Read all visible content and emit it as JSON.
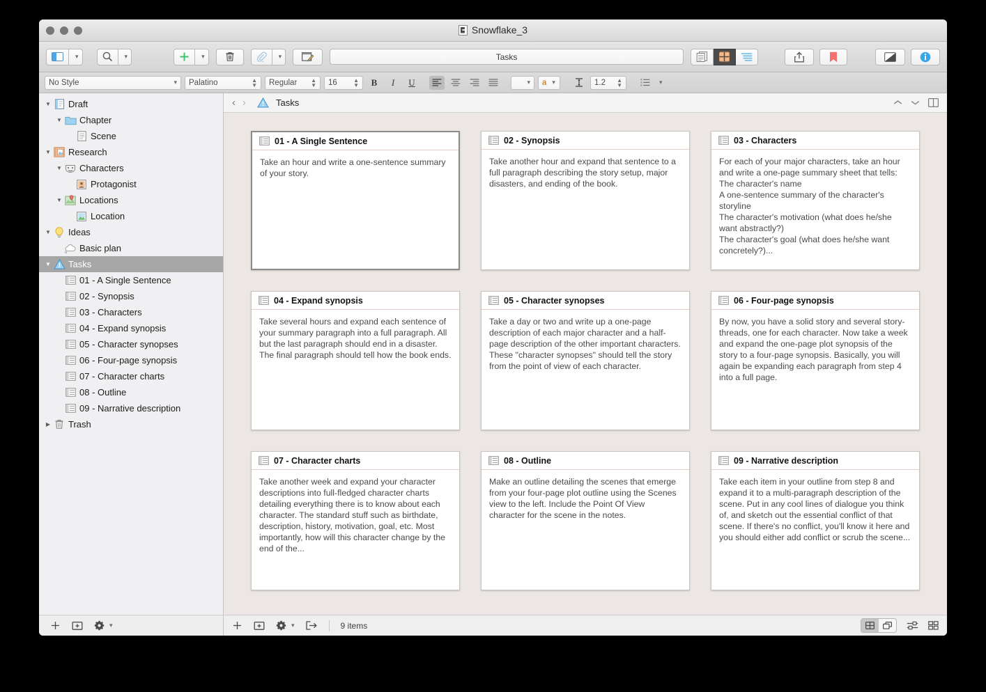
{
  "window": {
    "title": "Snowflake_3",
    "doc_icon": "scrivener-document-icon"
  },
  "toolbar": {
    "view_layout_label": "view-layout",
    "search_label": "search",
    "add_label": "add",
    "trash_label": "trash",
    "attach_label": "attach",
    "compose_label": "compose",
    "title_field_value": "Tasks",
    "mode_scrivenings": "scrivenings-view",
    "mode_corkboard": "corkboard-view",
    "mode_outliner": "outliner-view",
    "share_label": "share",
    "bookmark_label": "bookmark",
    "inspector_toggle_label": "toggle-inspector",
    "info_label": "inspector-info"
  },
  "format_bar": {
    "style": "No Style",
    "font": "Palatino",
    "weight": "Regular",
    "size": "16",
    "bold": "B",
    "italic": "I",
    "underline": "U",
    "line_spacing": "1.2",
    "text_color_glyph": "a"
  },
  "breadcrumb": {
    "back": "‹",
    "forward": "›",
    "icon": "tasks-warning-icon",
    "label": "Tasks"
  },
  "sidebar": {
    "items": [
      {
        "label": "Draft",
        "indent": 0,
        "twisty": "down",
        "icon": "draft-icon",
        "selected": false
      },
      {
        "label": "Chapter",
        "indent": 1,
        "twisty": "down",
        "icon": "folder-icon",
        "selected": false
      },
      {
        "label": "Scene",
        "indent": 2,
        "twisty": "none",
        "icon": "document-icon",
        "selected": false
      },
      {
        "label": "Research",
        "indent": 0,
        "twisty": "down",
        "icon": "research-icon",
        "selected": false
      },
      {
        "label": "Characters",
        "indent": 1,
        "twisty": "down",
        "icon": "masks-icon",
        "selected": false
      },
      {
        "label": "Protagonist",
        "indent": 2,
        "twisty": "none",
        "icon": "person-icon",
        "selected": false
      },
      {
        "label": "Locations",
        "indent": 1,
        "twisty": "down",
        "icon": "map-pin-icon",
        "selected": false
      },
      {
        "label": "Location",
        "indent": 2,
        "twisty": "none",
        "icon": "image-icon",
        "selected": false
      },
      {
        "label": "Ideas",
        "indent": 0,
        "twisty": "down",
        "icon": "lightbulb-icon",
        "selected": false
      },
      {
        "label": "Basic plan",
        "indent": 1,
        "twisty": "none",
        "icon": "cloud-icon",
        "selected": false
      },
      {
        "label": "Tasks",
        "indent": 0,
        "twisty": "down",
        "icon": "warning-icon",
        "selected": true
      },
      {
        "label": "01 - A Single Sentence",
        "indent": 1,
        "twisty": "none",
        "icon": "index-card-icon",
        "selected": false
      },
      {
        "label": "02 - Synopsis",
        "indent": 1,
        "twisty": "none",
        "icon": "index-card-icon",
        "selected": false
      },
      {
        "label": "03 - Characters",
        "indent": 1,
        "twisty": "none",
        "icon": "index-card-icon",
        "selected": false
      },
      {
        "label": "04 - Expand synopsis",
        "indent": 1,
        "twisty": "none",
        "icon": "index-card-icon",
        "selected": false
      },
      {
        "label": "05 - Character synopses",
        "indent": 1,
        "twisty": "none",
        "icon": "index-card-icon",
        "selected": false
      },
      {
        "label": "06 - Four-page synopsis",
        "indent": 1,
        "twisty": "none",
        "icon": "index-card-icon",
        "selected": false
      },
      {
        "label": "07 - Character charts",
        "indent": 1,
        "twisty": "none",
        "icon": "index-card-icon",
        "selected": false
      },
      {
        "label": "08 - Outline",
        "indent": 1,
        "twisty": "none",
        "icon": "index-card-icon",
        "selected": false
      },
      {
        "label": "09 - Narrative description",
        "indent": 1,
        "twisty": "none",
        "icon": "index-card-icon",
        "selected": false
      },
      {
        "label": "Trash",
        "indent": 0,
        "twisty": "right",
        "icon": "trash-icon",
        "selected": false
      }
    ],
    "footer": {
      "add": "add-item",
      "add_folder": "add-folder",
      "settings": "settings"
    }
  },
  "corkboard": {
    "cards": [
      {
        "title": "01 - A Single Sentence",
        "text": "Take an hour and write a one-sentence summary of your story.",
        "selected": true
      },
      {
        "title": "02 - Synopsis",
        "text": "Take another hour and expand that sentence to a full paragraph describing the story setup, major disasters, and ending of the book.",
        "selected": false
      },
      {
        "title": "03 - Characters",
        "text": "For each of your major characters, take an hour and write a one-page summary sheet that tells:\nThe character's name\nA one-sentence summary of the character's storyline\nThe character's motivation (what does he/she want abstractly?)\nThe character's goal (what does he/she want concretely?)...",
        "selected": false
      },
      {
        "title": "04 - Expand synopsis",
        "text": "Take several hours and expand each sentence of your summary paragraph into a full paragraph. All but the last paragraph should end in a disaster. The final paragraph should tell how the book ends.",
        "selected": false
      },
      {
        "title": "05 - Character synopses",
        "text": "Take a day or two and write up a one-page description of each major character and a half-page description of the other important characters. These \"character synopses\" should tell the story from the point of view of each character.",
        "selected": false
      },
      {
        "title": "06 - Four-page synopsis",
        "text": "By now, you have a solid story and several story-threads, one for each character. Now take a week and expand the one-page plot synopsis of the story to a four-page synopsis. Basically, you will again be expanding each paragraph from step 4 into a full page.",
        "selected": false
      },
      {
        "title": "07 - Character charts",
        "text": "Take another week and expand your character descriptions into full-fledged character charts detailing everything there is to know about each character. The standard stuff such as birthdate, description, history, motivation, goal, etc. Most importantly, how will this character change by the end of the...",
        "selected": false
      },
      {
        "title": "08 - Outline",
        "text": "Make an outline detailing the scenes that emerge from your four-page plot outline using the Scenes view to the left. Include the Point Of View character for the scene in the notes.",
        "selected": false
      },
      {
        "title": "09 - Narrative description",
        "text": "Take each item in your outline from step 8 and expand it to a multi-paragraph description of the scene. Put in any cool lines of dialogue you think of, and sketch out the essential conflict of that scene. If there's no conflict, you'll know it here and you should either add conflict or scrub the scene...",
        "selected": false
      }
    ]
  },
  "statusbar": {
    "add": "add-document",
    "add_folder": "add-folder",
    "settings": "settings",
    "export": "export",
    "count": "9 items",
    "view_cards": "card-view",
    "view_stack": "stack-view",
    "arrange_freeform": "freeform-arrange",
    "arrange_grid": "grid-arrange"
  },
  "colors": {
    "accent_blue": "#4ca6e8",
    "card_divider": "#e3cfc8",
    "corkboard_bg": "#ece7e4",
    "selection_gray": "#a6a6a6",
    "bookmark_red": "#f4706e",
    "add_green": "#3ec46d"
  }
}
